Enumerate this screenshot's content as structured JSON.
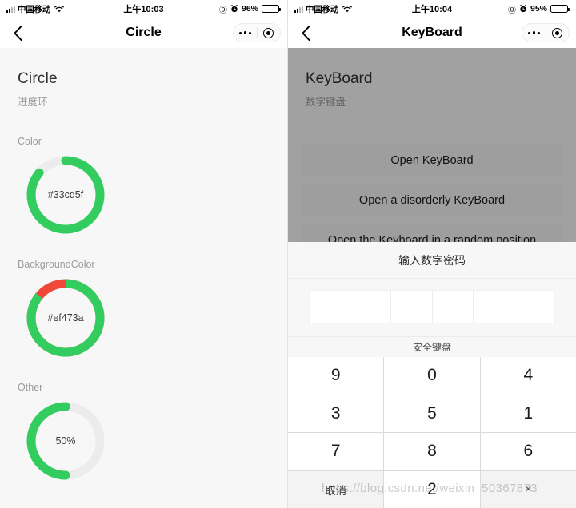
{
  "theme": {
    "green": "#33cd5f",
    "red": "#ef473a",
    "track_gray": "#ececec",
    "page_bg": "#f7f7f7",
    "battery_yellow": "#ffcc00"
  },
  "screens": [
    {
      "status_bar": {
        "carrier": "中国移动",
        "time": "上午10:03",
        "at_icon": "at-icon",
        "alarm_icon": "alarm-clock-icon",
        "battery_percent": "96%",
        "battery_level": 96,
        "signal_icon": "signal-bars-icon",
        "wifi_icon": "wifi-icon"
      },
      "nav": {
        "back_icon": "back-chevron-icon",
        "title": "Circle",
        "more_icon": "more-dots-icon",
        "target_icon": "target-circle-icon"
      },
      "header": {
        "title": "Circle",
        "subtitle": "进度环"
      },
      "sections": [
        {
          "label": "Color",
          "ring": {
            "center_text": "#33cd5f",
            "percent": 86,
            "progress_color": "#33cd5f",
            "background_color": "#ececec"
          }
        },
        {
          "label": "BackgroundColor",
          "ring": {
            "center_text": "#ef473a",
            "percent": 86,
            "progress_color": "#33cd5f",
            "background_color": "#ef473a"
          }
        },
        {
          "label": "Other",
          "ring": {
            "center_text": "50%",
            "percent": 50,
            "progress_color": "#33cd5f",
            "background_color": "#ececec"
          }
        }
      ]
    },
    {
      "status_bar": {
        "carrier": "中国移动",
        "time": "上午10:04",
        "at_icon": "at-icon",
        "alarm_icon": "alarm-clock-icon",
        "battery_percent": "95%",
        "battery_level": 95,
        "signal_icon": "signal-bars-icon",
        "wifi_icon": "wifi-icon"
      },
      "nav": {
        "back_icon": "back-chevron-icon",
        "title": "KeyBoard",
        "more_icon": "more-dots-icon",
        "target_icon": "target-circle-icon"
      },
      "header": {
        "title": "KeyBoard",
        "subtitle": "数字键盘"
      },
      "buttons": [
        {
          "label": "Open KeyBoard"
        },
        {
          "label": "Open a disorderly KeyBoard"
        },
        {
          "label": "Open the Keyboard in a random position"
        }
      ],
      "password_modal": {
        "title": "输入数字密码",
        "cells": 6,
        "entered": [
          "",
          "",
          "",
          "",
          "",
          ""
        ],
        "keyboard_label": "安全键盘",
        "keys": [
          {
            "label": "9",
            "type": "digit"
          },
          {
            "label": "0",
            "type": "digit"
          },
          {
            "label": "4",
            "type": "digit"
          },
          {
            "label": "3",
            "type": "digit"
          },
          {
            "label": "5",
            "type": "digit"
          },
          {
            "label": "1",
            "type": "digit"
          },
          {
            "label": "7",
            "type": "digit"
          },
          {
            "label": "8",
            "type": "digit"
          },
          {
            "label": "6",
            "type": "digit"
          },
          {
            "label": "取消",
            "type": "cancel"
          },
          {
            "label": "2",
            "type": "digit"
          },
          {
            "label": "×",
            "type": "delete"
          }
        ]
      },
      "watermark": "https://blog.csdn.net/weixin_50367873"
    }
  ]
}
